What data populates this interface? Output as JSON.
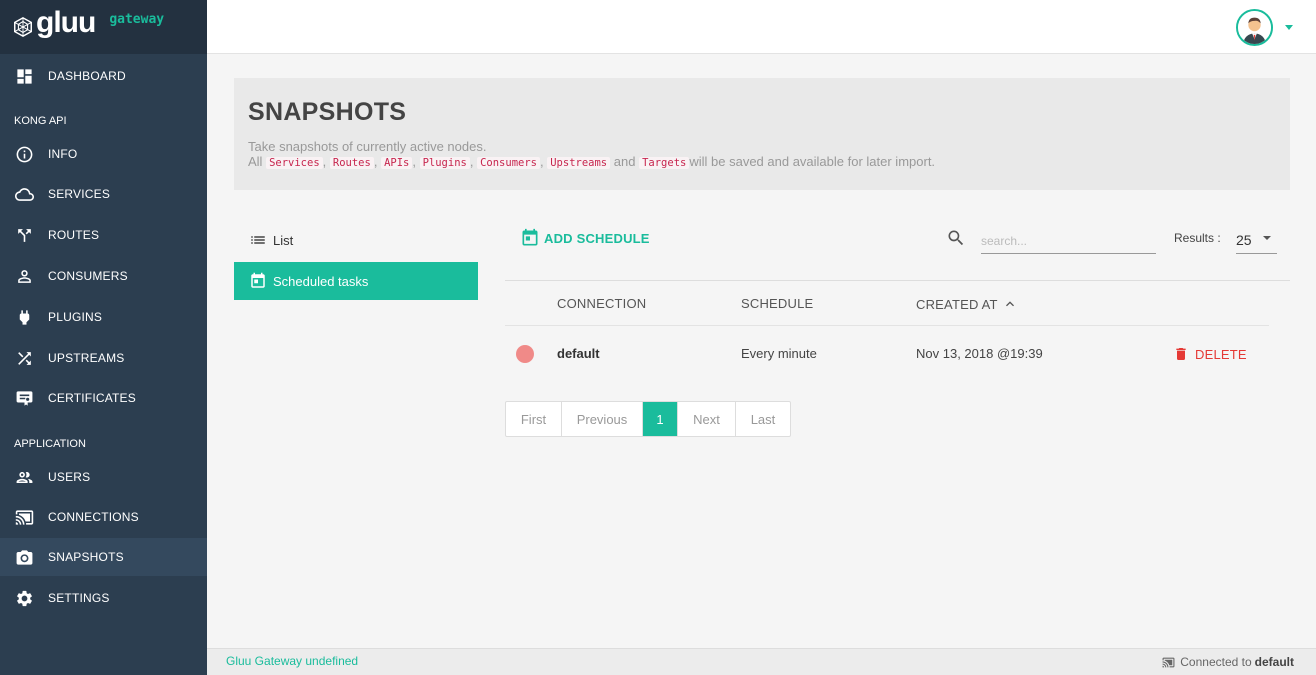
{
  "brand": {
    "logo_text": "gluu",
    "sub_text": "gateway"
  },
  "sidebar": {
    "items": [
      {
        "label": "DASHBOARD",
        "icon": "dashboard-icon"
      },
      {
        "label": "INFO",
        "icon": "info-icon"
      },
      {
        "label": "SERVICES",
        "icon": "cloud-icon"
      },
      {
        "label": "ROUTES",
        "icon": "routes-icon"
      },
      {
        "label": "CONSUMERS",
        "icon": "person-icon"
      },
      {
        "label": "PLUGINS",
        "icon": "plug-icon"
      },
      {
        "label": "UPSTREAMS",
        "icon": "shuffle-icon"
      },
      {
        "label": "CERTIFICATES",
        "icon": "certificate-icon"
      },
      {
        "label": "USERS",
        "icon": "users-icon"
      },
      {
        "label": "CONNECTIONS",
        "icon": "cast-icon"
      },
      {
        "label": "SNAPSHOTS",
        "icon": "camera-icon"
      },
      {
        "label": "SETTINGS",
        "icon": "gear-icon"
      }
    ],
    "sections": {
      "kong_api": "KONG API",
      "application": "APPLICATION"
    }
  },
  "header": {
    "title": "SNAPSHOTS",
    "desc_line1": "Take snapshots of currently active nodes.",
    "desc_all": "All",
    "chips": [
      "Services",
      "Routes",
      "APIs",
      "Plugins",
      "Consumers",
      "Upstreams",
      "Targets"
    ],
    "desc_and": "and",
    "desc_tail": "will be saved and available for later import."
  },
  "tabs": {
    "list": "List",
    "scheduled": "Scheduled tasks"
  },
  "toolbar": {
    "add_label": "ADD SCHEDULE",
    "search_placeholder": "search...",
    "results_label": "Results :",
    "results_value": "25"
  },
  "table": {
    "headers": {
      "connection": "CONNECTION",
      "schedule": "SCHEDULE",
      "created_at": "CREATED AT"
    },
    "rows": [
      {
        "connection": "default",
        "schedule": "Every minute",
        "created_at": "Nov 13, 2018 @19:39",
        "delete_label": "DELETE",
        "status_color": "#f08a88"
      }
    ]
  },
  "pagination": {
    "first": "First",
    "previous": "Previous",
    "current": "1",
    "next": "Next",
    "last": "Last"
  },
  "footer": {
    "left": "Gluu Gateway undefined",
    "connected_prefix": "Connected to",
    "connected_name": "default"
  },
  "colors": {
    "accent": "#1abc9c",
    "sidebar": "#2c3e50",
    "danger": "#e53935"
  }
}
